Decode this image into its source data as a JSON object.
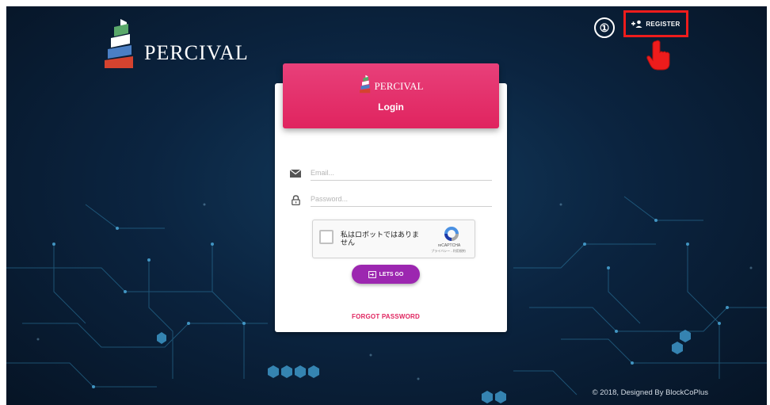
{
  "brand": {
    "name": "PERCIVAL"
  },
  "annotation": {
    "step": "①"
  },
  "register": {
    "label": "REGISTER"
  },
  "login_card": {
    "brand": "PERCIVAL",
    "title": "Login",
    "email_placeholder": "Email...",
    "password_placeholder": "Password...",
    "recaptcha": {
      "label": "私はロボットではありません",
      "brand": "reCAPTCHA",
      "links": "プライバシー - 利用規約"
    },
    "submit_label": "LETS GO",
    "forgot_label": "FORGOT PASSWORD"
  },
  "footer": {
    "text": "© 2018, Designed By BlockCoPlus"
  },
  "colors": {
    "header_pink": "#e0245f",
    "button_purple": "#9c27b0",
    "annotation_red": "#ee1c1c",
    "background_navy": "#0b2440"
  },
  "icons": [
    "percival-logo-icon",
    "add-user-icon",
    "pointing-hand-icon",
    "envelope-icon",
    "lock-icon",
    "recaptcha-icon",
    "login-icon"
  ]
}
